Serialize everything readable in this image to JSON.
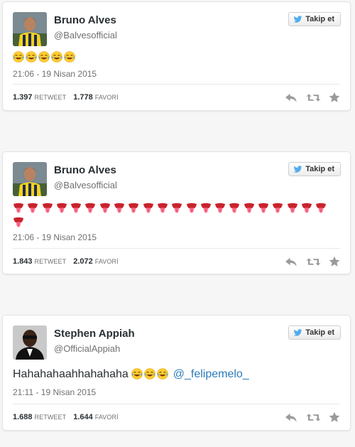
{
  "tweets": [
    {
      "name": "Bruno Alves",
      "handle": "@Balvesofficial",
      "follow_label": "Takip et",
      "text": "",
      "emoji_line1": [
        "joy-emoji",
        "joy-emoji",
        "joy-emoji",
        "joy-emoji",
        "joy-emoji"
      ],
      "date": "21:06 - 19 Nisan 2015",
      "retweets": "1.397",
      "retweet_label": "RETWEET",
      "favorites": "1.778",
      "favorite_label": "FAVORİ"
    },
    {
      "name": "Bruno Alves",
      "handle": "@Balvesofficial",
      "follow_label": "Takip et",
      "text": "",
      "emoji_count": 23,
      "emoji_name": "tongue-emoji",
      "date": "21:06 - 19 Nisan 2015",
      "retweets": "1.843",
      "retweet_label": "RETWEET",
      "favorites": "2.072",
      "favorite_label": "FAVORİ"
    },
    {
      "name": "Stephen Appiah",
      "handle": "@OfficialAppiah",
      "follow_label": "Takip et",
      "text": "Hahahahaahhahahaha",
      "emoji_count": 3,
      "emoji_name": "joy-emoji",
      "mention": "@_felipemelo_",
      "date": "21:11 - 19 Nisan 2015",
      "retweets": "1.688",
      "retweet_label": "RETWEET",
      "favorites": "1.644",
      "favorite_label": "FAVORİ"
    }
  ],
  "colors": {
    "link": "#2b7bb9",
    "twitter_blue": "#55acee",
    "icon_gray": "#9a9a9a",
    "joy_face": "#ffcc33",
    "tongue_face": "#c8232c"
  }
}
